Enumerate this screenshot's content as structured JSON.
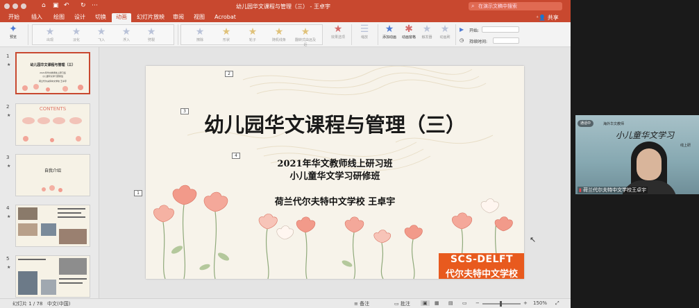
{
  "window": {
    "title": "幼儿园华文课程与管理（三） - 王卓宇",
    "search_placeholder": "在演示文稿中搜索",
    "share_label": "共享"
  },
  "tabs": [
    {
      "label": "开始"
    },
    {
      "label": "插入"
    },
    {
      "label": "绘图"
    },
    {
      "label": "设计"
    },
    {
      "label": "切换"
    },
    {
      "label": "动画",
      "active": true
    },
    {
      "label": "幻灯片放映"
    },
    {
      "label": "审阅"
    },
    {
      "label": "视图"
    },
    {
      "label": "Acrobat"
    }
  ],
  "ribbon": {
    "preview_label": "预览",
    "effects": [
      "出现",
      "淡化",
      "飞入",
      "浮入",
      "劈裂",
      "擦除",
      "形状",
      "轮子",
      "随机线条",
      "翻转式由远及近",
      "缩放",
      "旋转"
    ],
    "effect_options": "效果选项",
    "add_animation": "添加动画",
    "animation_pane": "动画窗格",
    "trigger": "触发器",
    "animation_painter": "动画刷",
    "start_label": "开始:",
    "duration_label": "持续时间:"
  },
  "slides": [
    {
      "num": "1",
      "title": "幼儿园华文课程与管理（三）",
      "lines": [
        "2021年华文教师线上研习班",
        "小儿童华文学习研修班",
        "荷兰代尔夫特中文学校 王卓宇"
      ]
    },
    {
      "num": "2",
      "title": "CONTENTS",
      "lines": []
    },
    {
      "num": "3",
      "title": "自我介绍",
      "lines": []
    },
    {
      "num": "4",
      "title": "",
      "lines": []
    },
    {
      "num": "5",
      "title": "",
      "lines": []
    }
  ],
  "main_slide": {
    "title": "幼儿园华文课程与管理（三）",
    "subtitle1": "2021年华文教师线上研习班",
    "subtitle2": "小儿童华文学习研修班",
    "school": "荷兰代尔夫特中文学校  王卓宇",
    "anim_tags": [
      "1",
      "2",
      "3",
      "4"
    ],
    "logo_top": "SCS-DELFT",
    "logo_bottom": "代尔夫特中文学校"
  },
  "status": {
    "slide_count": "幻灯片 1 / 78",
    "language": "中文(中国)",
    "notes": "备注",
    "comments": "批注",
    "zoom": "150%"
  },
  "video": {
    "pill": "通话中",
    "banner_small": "海外华文教师",
    "banner_large": "小儿童华文学习",
    "banner_tag": "线上研",
    "name": "荷兰代尔夫特中文学校王卓宇"
  }
}
